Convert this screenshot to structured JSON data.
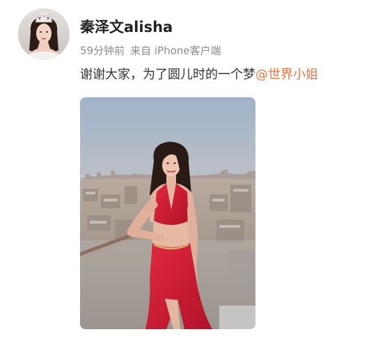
{
  "post": {
    "author": {
      "name": "秦泽文alisha"
    },
    "meta": {
      "time": "59分钟前",
      "source": "来自 iPhone客户端"
    },
    "content": {
      "text": "谢谢大家，为了圆儿时的一个梦",
      "mention": "@世界小姐"
    },
    "image": {
      "subject": "woman-in-red-dress-on-rooftop"
    }
  },
  "colors": {
    "mention": "#eb7340",
    "meta": "#8b8b8b",
    "name": "#222222",
    "dress": "#d0182f"
  }
}
